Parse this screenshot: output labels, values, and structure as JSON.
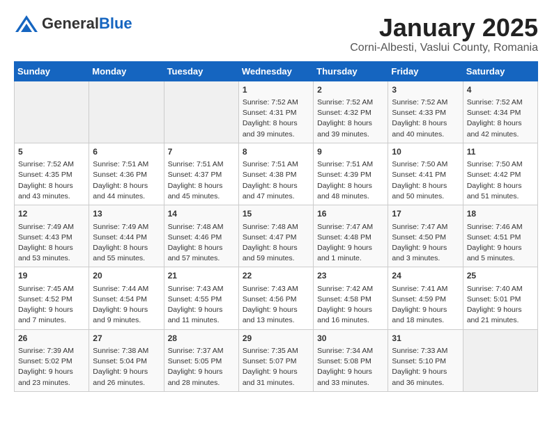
{
  "header": {
    "logo_general": "General",
    "logo_blue": "Blue",
    "title": "January 2025",
    "subtitle": "Corni-Albesti, Vaslui County, Romania"
  },
  "calendar": {
    "weekdays": [
      "Sunday",
      "Monday",
      "Tuesday",
      "Wednesday",
      "Thursday",
      "Friday",
      "Saturday"
    ],
    "weeks": [
      [
        {
          "day": "",
          "content": ""
        },
        {
          "day": "",
          "content": ""
        },
        {
          "day": "",
          "content": ""
        },
        {
          "day": "1",
          "content": "Sunrise: 7:52 AM\nSunset: 4:31 PM\nDaylight: 8 hours\nand 39 minutes."
        },
        {
          "day": "2",
          "content": "Sunrise: 7:52 AM\nSunset: 4:32 PM\nDaylight: 8 hours\nand 39 minutes."
        },
        {
          "day": "3",
          "content": "Sunrise: 7:52 AM\nSunset: 4:33 PM\nDaylight: 8 hours\nand 40 minutes."
        },
        {
          "day": "4",
          "content": "Sunrise: 7:52 AM\nSunset: 4:34 PM\nDaylight: 8 hours\nand 42 minutes."
        }
      ],
      [
        {
          "day": "5",
          "content": "Sunrise: 7:52 AM\nSunset: 4:35 PM\nDaylight: 8 hours\nand 43 minutes."
        },
        {
          "day": "6",
          "content": "Sunrise: 7:51 AM\nSunset: 4:36 PM\nDaylight: 8 hours\nand 44 minutes."
        },
        {
          "day": "7",
          "content": "Sunrise: 7:51 AM\nSunset: 4:37 PM\nDaylight: 8 hours\nand 45 minutes."
        },
        {
          "day": "8",
          "content": "Sunrise: 7:51 AM\nSunset: 4:38 PM\nDaylight: 8 hours\nand 47 minutes."
        },
        {
          "day": "9",
          "content": "Sunrise: 7:51 AM\nSunset: 4:39 PM\nDaylight: 8 hours\nand 48 minutes."
        },
        {
          "day": "10",
          "content": "Sunrise: 7:50 AM\nSunset: 4:41 PM\nDaylight: 8 hours\nand 50 minutes."
        },
        {
          "day": "11",
          "content": "Sunrise: 7:50 AM\nSunset: 4:42 PM\nDaylight: 8 hours\nand 51 minutes."
        }
      ],
      [
        {
          "day": "12",
          "content": "Sunrise: 7:49 AM\nSunset: 4:43 PM\nDaylight: 8 hours\nand 53 minutes."
        },
        {
          "day": "13",
          "content": "Sunrise: 7:49 AM\nSunset: 4:44 PM\nDaylight: 8 hours\nand 55 minutes."
        },
        {
          "day": "14",
          "content": "Sunrise: 7:48 AM\nSunset: 4:46 PM\nDaylight: 8 hours\nand 57 minutes."
        },
        {
          "day": "15",
          "content": "Sunrise: 7:48 AM\nSunset: 4:47 PM\nDaylight: 8 hours\nand 59 minutes."
        },
        {
          "day": "16",
          "content": "Sunrise: 7:47 AM\nSunset: 4:48 PM\nDaylight: 9 hours\nand 1 minute."
        },
        {
          "day": "17",
          "content": "Sunrise: 7:47 AM\nSunset: 4:50 PM\nDaylight: 9 hours\nand 3 minutes."
        },
        {
          "day": "18",
          "content": "Sunrise: 7:46 AM\nSunset: 4:51 PM\nDaylight: 9 hours\nand 5 minutes."
        }
      ],
      [
        {
          "day": "19",
          "content": "Sunrise: 7:45 AM\nSunset: 4:52 PM\nDaylight: 9 hours\nand 7 minutes."
        },
        {
          "day": "20",
          "content": "Sunrise: 7:44 AM\nSunset: 4:54 PM\nDaylight: 9 hours\nand 9 minutes."
        },
        {
          "day": "21",
          "content": "Sunrise: 7:43 AM\nSunset: 4:55 PM\nDaylight: 9 hours\nand 11 minutes."
        },
        {
          "day": "22",
          "content": "Sunrise: 7:43 AM\nSunset: 4:56 PM\nDaylight: 9 hours\nand 13 minutes."
        },
        {
          "day": "23",
          "content": "Sunrise: 7:42 AM\nSunset: 4:58 PM\nDaylight: 9 hours\nand 16 minutes."
        },
        {
          "day": "24",
          "content": "Sunrise: 7:41 AM\nSunset: 4:59 PM\nDaylight: 9 hours\nand 18 minutes."
        },
        {
          "day": "25",
          "content": "Sunrise: 7:40 AM\nSunset: 5:01 PM\nDaylight: 9 hours\nand 21 minutes."
        }
      ],
      [
        {
          "day": "26",
          "content": "Sunrise: 7:39 AM\nSunset: 5:02 PM\nDaylight: 9 hours\nand 23 minutes."
        },
        {
          "day": "27",
          "content": "Sunrise: 7:38 AM\nSunset: 5:04 PM\nDaylight: 9 hours\nand 26 minutes."
        },
        {
          "day": "28",
          "content": "Sunrise: 7:37 AM\nSunset: 5:05 PM\nDaylight: 9 hours\nand 28 minutes."
        },
        {
          "day": "29",
          "content": "Sunrise: 7:35 AM\nSunset: 5:07 PM\nDaylight: 9 hours\nand 31 minutes."
        },
        {
          "day": "30",
          "content": "Sunrise: 7:34 AM\nSunset: 5:08 PM\nDaylight: 9 hours\nand 33 minutes."
        },
        {
          "day": "31",
          "content": "Sunrise: 7:33 AM\nSunset: 5:10 PM\nDaylight: 9 hours\nand 36 minutes."
        },
        {
          "day": "",
          "content": ""
        }
      ]
    ]
  }
}
